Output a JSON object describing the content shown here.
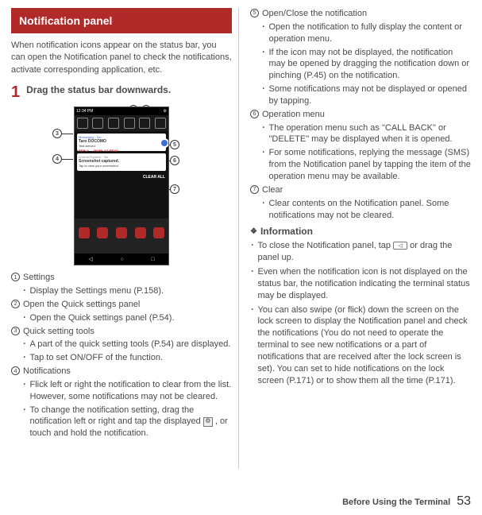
{
  "header": {
    "title": "Notification panel"
  },
  "intro": "When notification icons appear on the status bar, you can open the Notification panel to check the notifications, activate corresponding application, etc.",
  "step": {
    "num": "1",
    "title": "Drag the status bar downwards."
  },
  "screenshot": {
    "time": "12:34 PM",
    "notif1_app": "Messaging · 3m",
    "notif1_title": "Taro DOCOMO",
    "notif1_sub": "Test arrived",
    "reply": "REPLY",
    "mark_read": "MARK AS READ",
    "notif2_app": "Android System · 3m",
    "notif2_title": "Screenshot captured.",
    "notif2_sub": "Tap to view your screenshot.",
    "clear_all": "CLEAR ALL"
  },
  "callouts": {
    "c1": "1",
    "c2": "2",
    "c3": "3",
    "c4": "4",
    "c5": "5",
    "c6": "6",
    "c7": "7"
  },
  "left_items": [
    {
      "num": "1",
      "label": "Settings",
      "subs": [
        "Display the Settings menu (P.158)."
      ]
    },
    {
      "num": "2",
      "label": "Open the Quick settings panel",
      "subs": [
        "Open the Quick settings panel (P.54)."
      ]
    },
    {
      "num": "3",
      "label": "Quick setting tools",
      "subs": [
        "A part of the quick setting tools (P.54) are displayed.",
        "Tap to set ON/OFF of the function."
      ]
    },
    {
      "num": "4",
      "label": "Notifications",
      "subs": [
        "Flick left or right the notification to clear from the list. However, some notifications may not be cleared.",
        "To change the notification setting, drag the notification left or right and tap the displayed GEAR , or touch and hold the notification."
      ]
    }
  ],
  "right_items": [
    {
      "num": "5",
      "label": "Open/Close the notification",
      "subs": [
        "Open the notification to fully display the content or operation menu.",
        "If the icon may not be displayed, the notification may be opened by dragging the notification down or pinching (P.45) on the notification.",
        "Some notifications may not be displayed or opened by tapping."
      ]
    },
    {
      "num": "6",
      "label": "Operation menu",
      "subs": [
        "The operation menu such as \"CALL BACK\" or \"DELETE\" may be displayed when it is opened.",
        "For some notifications, replying the message (SMS) from the Notification panel by tapping the item of the operation menu may be available."
      ]
    },
    {
      "num": "7",
      "label": "Clear",
      "subs": [
        "Clear contents on the Notification panel. Some notifications may not be cleared."
      ]
    }
  ],
  "info": {
    "heading": "Information",
    "bullets": [
      "To close the Notification panel, tap BACK or drag the panel up.",
      "Even when the notification icon is not displayed on the status bar, the notification indicating the terminal status may be displayed.",
      "You can also swipe (or flick) down the screen on the lock screen to display the Notification panel and check the notifications (You do not need to operate the terminal to see new notifications or a part of notifications that are received after the lock screen is set). You can set to hide notifications on the lock screen (P.171) or to show them all the time (P.171)."
    ]
  },
  "footer": {
    "title": "Before Using the Terminal",
    "page": "53"
  }
}
